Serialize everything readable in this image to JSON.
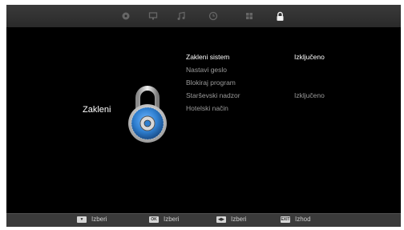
{
  "topbar": {
    "tabs": [
      {
        "icon": "picture-icon",
        "active": false
      },
      {
        "icon": "monitor-icon",
        "active": false
      },
      {
        "icon": "music-note-icon",
        "active": false
      },
      {
        "icon": "clock-icon",
        "active": false
      },
      {
        "icon": "grid-icon",
        "active": false
      },
      {
        "icon": "lock-icon",
        "active": true
      }
    ]
  },
  "menu": {
    "title": "Zakleni",
    "items": [
      {
        "label": "Zakleni sistem",
        "value": "Izključeno",
        "selected": true
      },
      {
        "label": "Nastavi geslo",
        "value": ""
      },
      {
        "label": "Blokiraj program",
        "value": ""
      },
      {
        "label": "Starševski nadzor",
        "value": "Izključeno"
      },
      {
        "label": "Hotelski način",
        "value": ""
      }
    ]
  },
  "footer": {
    "items": [
      {
        "key": "▼",
        "label": "Izberi"
      },
      {
        "key": "OK",
        "label": "Izberi"
      },
      {
        "key": "◀▶",
        "label": "Izberi"
      },
      {
        "key": "EXIT",
        "label": "Izhod"
      }
    ]
  },
  "colors": {
    "accent_blue": "#2f7fd0",
    "text_selected": "#ffffff",
    "text_dim": "#9a9a9a"
  }
}
